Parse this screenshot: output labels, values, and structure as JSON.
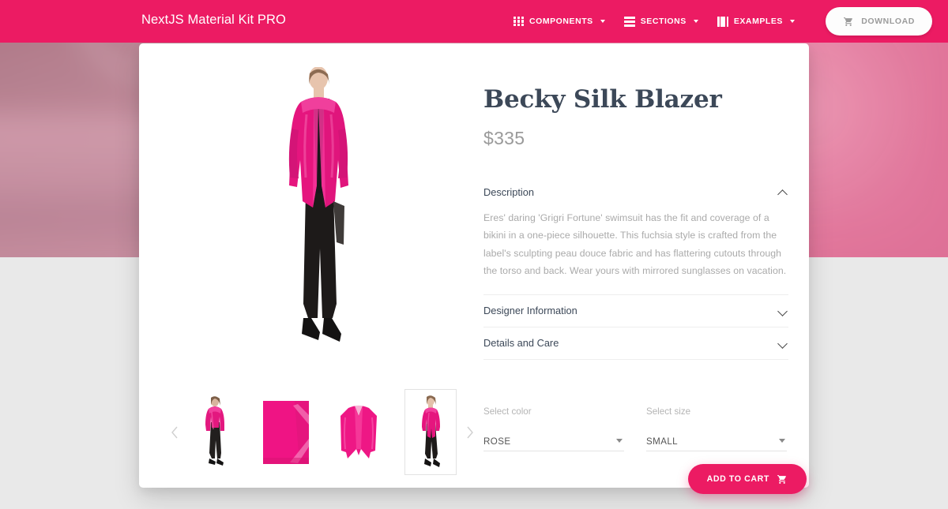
{
  "navbar": {
    "brand": "NextJS Material Kit PRO",
    "items": [
      {
        "label": "COMPONENTS",
        "icon": "apps-grid-icon",
        "has_caret": true
      },
      {
        "label": "SECTIONS",
        "icon": "view-stream-icon",
        "has_caret": true
      },
      {
        "label": "EXAMPLES",
        "icon": "art-track-icon",
        "has_caret": true
      }
    ],
    "download_label": "DOWNLOAD",
    "download_icon": "shopping-cart-icon",
    "background_color": "#ec1b63"
  },
  "product": {
    "title": "Becky Silk Blazer",
    "price": "$335",
    "accordion": [
      {
        "title": "Description",
        "expanded": true,
        "chevron": "chevron-up-icon",
        "body": "Eres' daring 'Grigri Fortune' swimsuit has the fit and coverage of a bikini in a one-piece silhouette. This fuchsia style is crafted from the label's sculpting peau douce fabric and has flattering cutouts through the torso and back. Wear yours with mirrored sunglasses on vacation."
      },
      {
        "title": "Designer Information",
        "expanded": false,
        "chevron": "chevron-down-icon",
        "body": ""
      },
      {
        "title": "Details and Care",
        "expanded": false,
        "chevron": "chevron-down-icon",
        "body": ""
      }
    ],
    "options": {
      "color": {
        "label": "Select color",
        "value": "ROSE"
      },
      "size": {
        "label": "Select size",
        "value": "SMALL"
      }
    },
    "add_to_cart": {
      "label": "ADD TO CART",
      "icon": "shopping-cart-icon",
      "color": "#ec1b63"
    },
    "gallery": {
      "prev_icon": "chevron-left-icon",
      "next_icon": "chevron-right-icon",
      "main_image_alt": "Model wearing pink silk blazer with black leather pants",
      "thumbnails": [
        {
          "alt": "Model back view",
          "selected": false
        },
        {
          "alt": "Fabric detail swatch",
          "selected": false
        },
        {
          "alt": "Blazer flat lay",
          "selected": false
        },
        {
          "alt": "Model front view",
          "selected": true
        }
      ]
    }
  },
  "colors": {
    "brand_pink": "#ec1b63",
    "title_text": "#3c4858",
    "body_text": "#aaaaaa",
    "page_background": "#e9e9e9"
  }
}
